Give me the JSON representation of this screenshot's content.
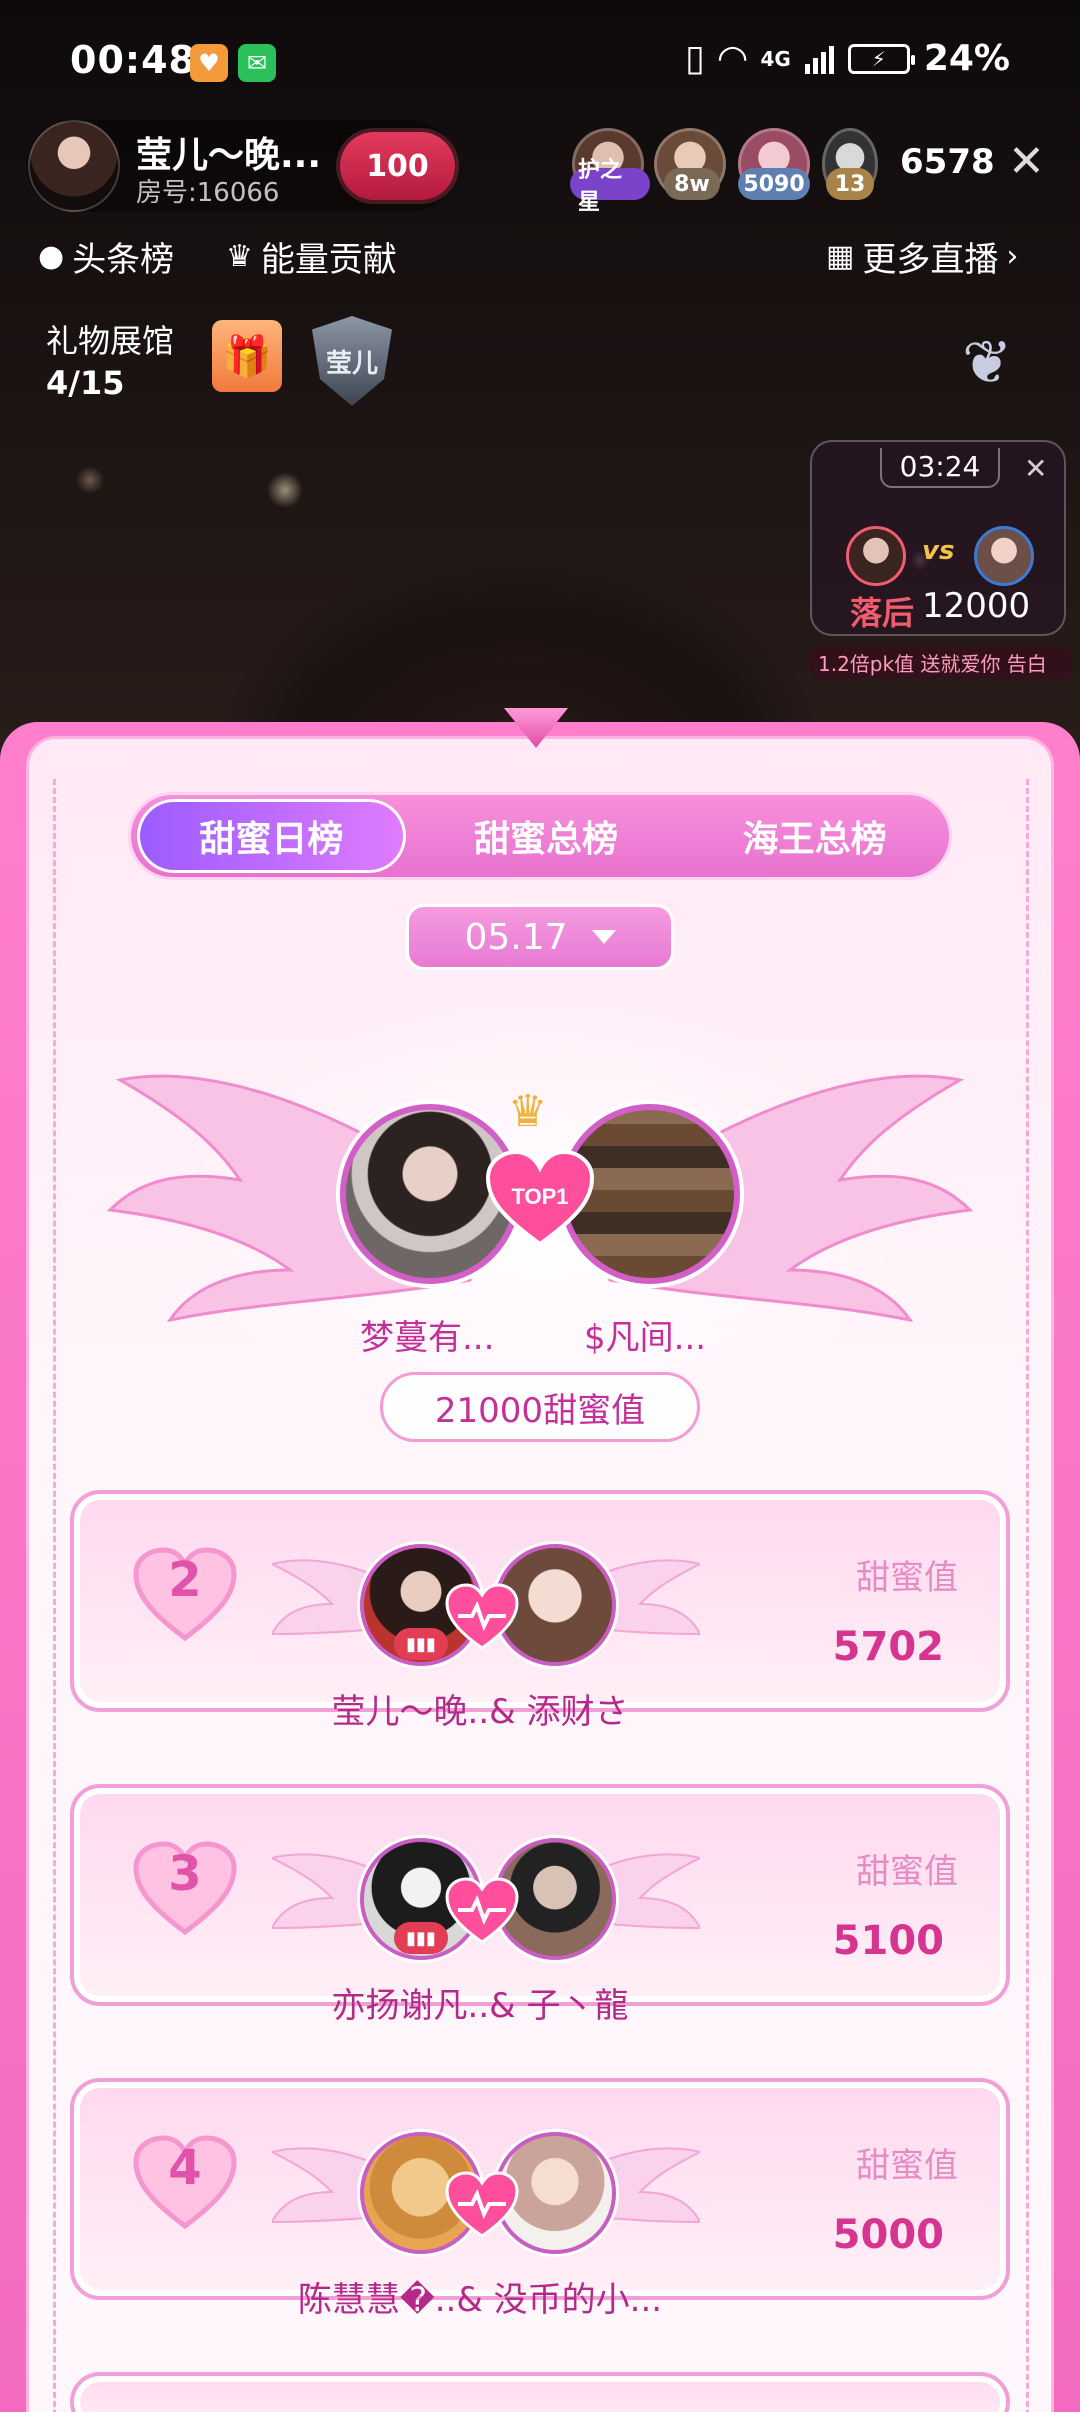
{
  "status_bar": {
    "time": "00:48",
    "network": "4G",
    "battery": "24%"
  },
  "header": {
    "host_name": "莹儿～晚...",
    "room_label": "房号:16066",
    "love_badge": "100",
    "viewers": [
      {
        "tag": "护之星",
        "tag_color": "#7b43c9"
      },
      {
        "tag": "8w",
        "tag_color": "#7a6a55"
      },
      {
        "tag": "5090",
        "tag_color": "#5e7fb0"
      },
      {
        "tag": "13",
        "tag_color": "#a8844a"
      }
    ],
    "viewer_count": "6578"
  },
  "nav": {
    "headline_rank": "头条榜",
    "energy_contrib": "能量贡献",
    "more_live": "更多直播"
  },
  "gift_hall": {
    "title": "礼物展馆",
    "count": "4/15",
    "shield_text": "莹儿"
  },
  "pk": {
    "timer": "03:24",
    "vs": "vs",
    "status": "落后",
    "gap": "12000",
    "ticker": "1.2倍pk值  送就爱你  告白"
  },
  "panel": {
    "tabs": [
      "甜蜜日榜",
      "甜蜜总榜",
      "海王总榜"
    ],
    "active_tab": 0,
    "date": "05.17",
    "top1": {
      "badge": "TOP1",
      "left_name": "梦蔓有...",
      "right_name": "$凡间...",
      "score": "21000甜蜜值"
    },
    "ranks": [
      {
        "rank": "2",
        "names": "莹儿～晚..& 添财さ",
        "value_label": "甜蜜值",
        "value": "5702",
        "mic": true
      },
      {
        "rank": "3",
        "names": "亦扬谢凡..& 子丶龍",
        "value_label": "甜蜜值",
        "value": "5100",
        "mic": true
      },
      {
        "rank": "4",
        "names": "陈慧慧�..& 没币的小...",
        "value_label": "甜蜜值",
        "value": "5000",
        "mic": false
      }
    ]
  },
  "colors": {
    "accent": "#e053a8",
    "panel_pink": "#f26bc0",
    "behind": "#f25c6e"
  }
}
